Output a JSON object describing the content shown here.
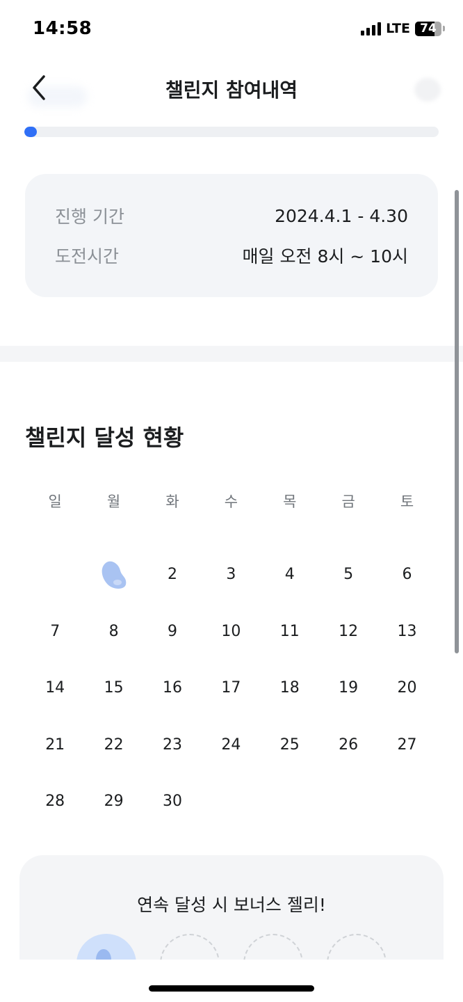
{
  "status_bar": {
    "time": "14:58",
    "network": "LTE",
    "battery": "74",
    "battery_level": 0.74,
    "signal_bars": 4
  },
  "header": {
    "title": "챌린지 참여내역",
    "back_icon": "chevron-left-icon"
  },
  "progress": {
    "value": 0.03,
    "color": "#2f6ff6"
  },
  "info": {
    "period_label": "진행 기간",
    "period_value": "2024.4.1 - 4.30",
    "time_label": "도전시간",
    "time_value": "매일 오전 8시 ~ 10시"
  },
  "calendar": {
    "title": "챌린지 달성 현황",
    "weekdays": [
      "일",
      "월",
      "화",
      "수",
      "목",
      "금",
      "토"
    ],
    "first_weekday_index": 1,
    "days": [
      {
        "label": "",
        "achieved": true,
        "icon": "jelly-icon"
      },
      {
        "label": "2"
      },
      {
        "label": "3"
      },
      {
        "label": "4"
      },
      {
        "label": "5"
      },
      {
        "label": "6"
      },
      {
        "label": "7"
      },
      {
        "label": "8"
      },
      {
        "label": "9"
      },
      {
        "label": "10"
      },
      {
        "label": "11"
      },
      {
        "label": "12"
      },
      {
        "label": "13"
      },
      {
        "label": "14"
      },
      {
        "label": "15"
      },
      {
        "label": "16"
      },
      {
        "label": "17"
      },
      {
        "label": "18"
      },
      {
        "label": "19"
      },
      {
        "label": "20"
      },
      {
        "label": "21"
      },
      {
        "label": "22"
      },
      {
        "label": "23"
      },
      {
        "label": "24"
      },
      {
        "label": "25"
      },
      {
        "label": "26"
      },
      {
        "label": "27"
      },
      {
        "label": "28"
      },
      {
        "label": "29"
      },
      {
        "label": "30"
      }
    ],
    "jelly_color": "#a9c3f2"
  },
  "bonus": {
    "title": "연속 달성 시 보너스 젤리!",
    "steps": [
      {
        "state": "active"
      },
      {
        "state": "locked"
      },
      {
        "state": "locked"
      },
      {
        "state": "locked"
      }
    ]
  }
}
